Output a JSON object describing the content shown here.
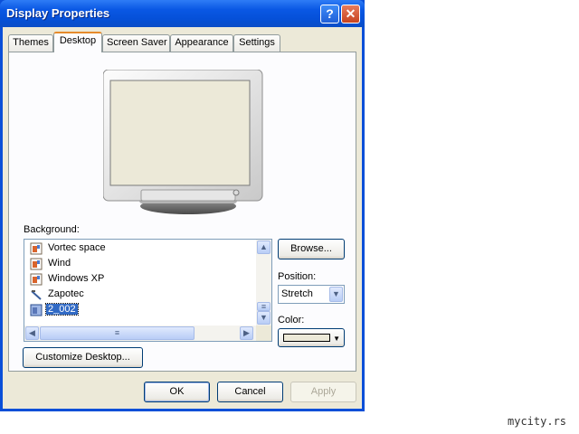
{
  "window": {
    "title": "Display Properties",
    "help_label": "?",
    "close_label": "✕"
  },
  "tabs": [
    {
      "label": "Themes",
      "active": false
    },
    {
      "label": "Desktop",
      "active": true
    },
    {
      "label": "Screen Saver",
      "active": false
    },
    {
      "label": "Appearance",
      "active": false
    },
    {
      "label": "Settings",
      "active": false
    }
  ],
  "desktop": {
    "background_label": "Background:",
    "background_items": [
      {
        "label": "Vortec space",
        "icon": "image-file-icon",
        "selected": false
      },
      {
        "label": "Wind",
        "icon": "image-file-icon",
        "selected": false
      },
      {
        "label": "Windows XP",
        "icon": "image-file-icon",
        "selected": false
      },
      {
        "label": "Zapotec",
        "icon": "image-file-icon",
        "selected": false
      },
      {
        "label": "2_002",
        "icon": "image-file-icon",
        "selected": true
      }
    ],
    "browse_label": "Browse...",
    "position_label": "Position:",
    "position_value": "Stretch",
    "color_label": "Color:",
    "color_value": "#ece9d8",
    "customize_label": "Customize Desktop...",
    "monitor_screen_color": "#ece9d8"
  },
  "footer": {
    "ok_label": "OK",
    "cancel_label": "Cancel",
    "apply_label": "Apply"
  },
  "watermark": "mycity.rs"
}
